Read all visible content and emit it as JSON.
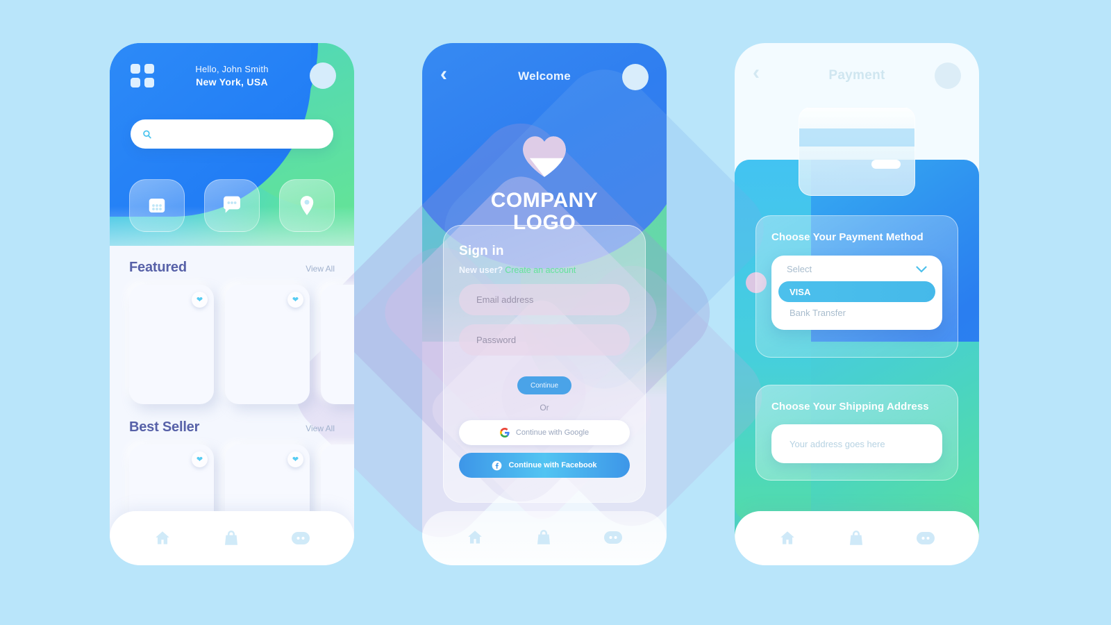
{
  "background_color": "#b9e5fa",
  "screen_home": {
    "menu_icon": "grid-menu-icon",
    "greeting_line1": "Hello, John Smith",
    "greeting_line2": "New York, USA",
    "avatar": "avatar-circle",
    "search": {
      "value": "",
      "placeholder": "",
      "icon": "search-icon"
    },
    "quick_actions": [
      {
        "icon": "categories-grid-icon",
        "name": "categories"
      },
      {
        "icon": "chat-bubble-icon",
        "name": "messages"
      },
      {
        "icon": "location-pin-icon",
        "name": "location"
      }
    ],
    "sections": [
      {
        "title": "Featured",
        "view_all": "View All",
        "cards": 3
      },
      {
        "title": "Best Seller",
        "view_all": "View All",
        "cards": 3
      }
    ],
    "favorite_icon": "heart-icon",
    "nav": [
      {
        "icon": "home-icon",
        "name": "home"
      },
      {
        "icon": "bag-icon",
        "name": "shop"
      },
      {
        "icon": "more-dots-icon",
        "name": "more"
      }
    ]
  },
  "screen_signin": {
    "back_icon": "chevron-left-icon",
    "title": "Welcome",
    "avatar": "avatar-circle",
    "logo_icon": "heart-logo-icon",
    "brand_line1": "COMPANY",
    "brand_line2": "LOGO",
    "heading": "Sign in",
    "new_user_label": "New user?",
    "create_account_link": "Create an account",
    "create_account_color": "#63e39a",
    "email": {
      "value": "",
      "placeholder": "Email address"
    },
    "password": {
      "value": "",
      "placeholder": "Password"
    },
    "continue_label": "Continue",
    "or_label": "Or",
    "google_label": "Continue with Google",
    "google_icon": "google-g-icon",
    "facebook_label": "Continue with Facebook",
    "facebook_icon": "facebook-f-icon",
    "nav": [
      {
        "icon": "home-icon",
        "name": "home"
      },
      {
        "icon": "bag-icon",
        "name": "shop"
      },
      {
        "icon": "more-dots-icon",
        "name": "more"
      }
    ]
  },
  "screen_payment": {
    "back_icon": "chevron-left-icon",
    "title": "Payment",
    "avatar": "avatar-circle",
    "card_graphic": "credit-card-icon",
    "payment_heading": "Choose Your Payment Method",
    "dropdown": {
      "placeholder": "Select",
      "chevron": "chevron-down-icon",
      "options": [
        {
          "label": "VISA",
          "selected": true
        },
        {
          "label": "Bank Transfer",
          "selected": false
        }
      ],
      "selected_color": "#4cc0ec"
    },
    "shipping_heading": "Choose Your Shipping Address",
    "address": {
      "value": "",
      "placeholder": "Your address goes here"
    },
    "nav": [
      {
        "icon": "home-icon",
        "name": "home"
      },
      {
        "icon": "bag-icon",
        "name": "shop"
      },
      {
        "icon": "more-dots-icon",
        "name": "more"
      }
    ]
  }
}
